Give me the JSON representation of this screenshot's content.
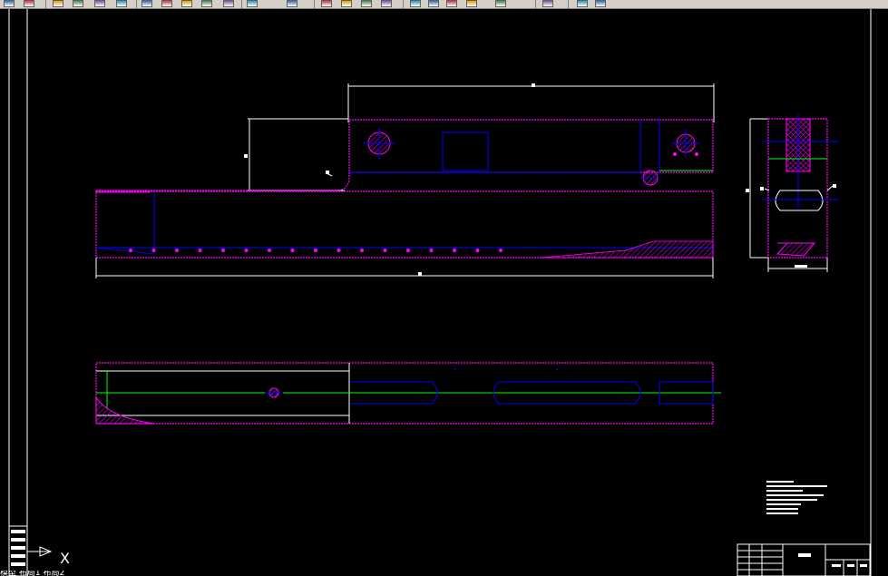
{
  "app": {
    "canvas_background": "#000000",
    "toolbar_background": "#d4d0c8"
  },
  "toolbar": {
    "icons": [
      "pan-icon",
      "save-icon",
      "plot-icon",
      "print-preview-icon",
      "publish-icon",
      "3d-publish-icon",
      "cut-icon",
      "copy-icon",
      "paste-icon",
      "match-properties-icon",
      "block-editor-icon",
      "undo-icon",
      "redo-icon",
      "pan-realtime-icon",
      "zoom-realtime-icon",
      "zoom-window-icon",
      "zoom-previous-icon",
      "text-style-icon",
      "dimension-style-icon",
      "table-style-icon",
      "multileader-style-icon",
      "calculator-icon",
      "help-icon",
      "layer-icon",
      "layer-state-icon"
    ]
  },
  "drawing": {
    "colors": {
      "outline": "#ff00ff",
      "body": "#0000ff",
      "center_line": "#00ff00",
      "dimension": "#ffffff",
      "hatch": "#ff00ff"
    }
  },
  "ucs": {
    "x_label": "X"
  },
  "bottom_tab": {
    "label": "模型  布局1  布局2"
  }
}
